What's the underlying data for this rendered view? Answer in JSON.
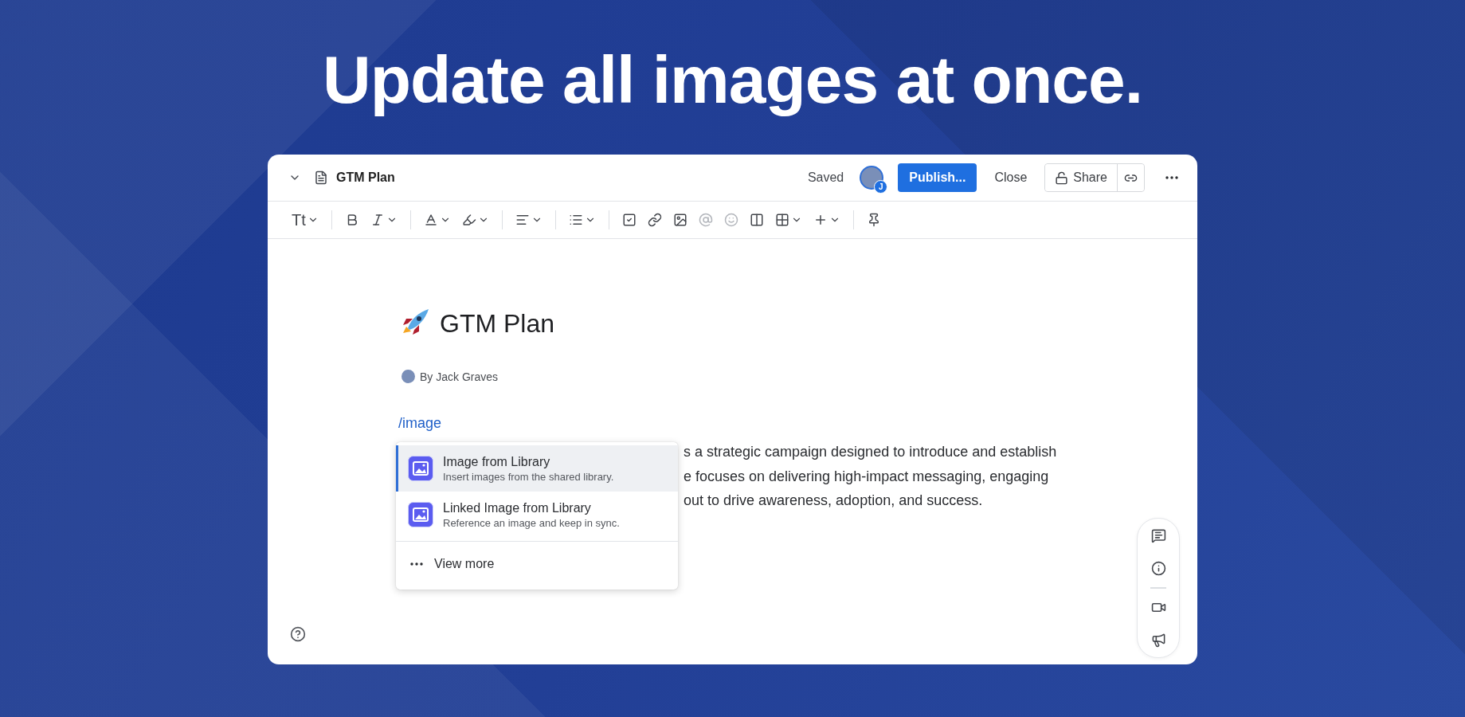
{
  "headline": "Update all images at once.",
  "topbar": {
    "title": "GTM Plan",
    "status": "Saved",
    "avatar_badge": "J",
    "publish": "Publish...",
    "close": "Close",
    "share": "Share"
  },
  "toolbar": {
    "text_style": "Tt",
    "tools": [
      {
        "kind": "text-style",
        "menu": true,
        "disabled": false
      },
      {
        "kind": "separator"
      },
      {
        "kind": "bold",
        "menu": false,
        "disabled": false
      },
      {
        "kind": "italic",
        "menu": true,
        "disabled": false
      },
      {
        "kind": "separator"
      },
      {
        "kind": "text-color",
        "menu": true,
        "disabled": false
      },
      {
        "kind": "highlight",
        "menu": true,
        "disabled": false
      },
      {
        "kind": "separator"
      },
      {
        "kind": "align",
        "menu": true,
        "disabled": false
      },
      {
        "kind": "separator"
      },
      {
        "kind": "list",
        "menu": true,
        "disabled": false
      },
      {
        "kind": "separator"
      },
      {
        "kind": "task",
        "menu": false,
        "disabled": false
      },
      {
        "kind": "link",
        "menu": false,
        "disabled": false
      },
      {
        "kind": "image",
        "menu": false,
        "disabled": false
      },
      {
        "kind": "mention",
        "menu": false,
        "disabled": true
      },
      {
        "kind": "emoji",
        "menu": false,
        "disabled": true
      },
      {
        "kind": "columns",
        "menu": false,
        "disabled": false
      },
      {
        "kind": "table",
        "menu": true,
        "disabled": false
      },
      {
        "kind": "insert",
        "menu": true,
        "disabled": false
      },
      {
        "kind": "separator"
      },
      {
        "kind": "pin",
        "menu": false,
        "disabled": false
      }
    ]
  },
  "document": {
    "title": "GTM Plan",
    "author": "By Jack Graves",
    "command": "/image",
    "paragraph_lines": [
      "s a strategic campaign designed to introduce and establish",
      "e focuses on delivering high-impact messaging, engaging",
      "out to drive awareness, adoption, and success."
    ]
  },
  "menu": {
    "items": [
      {
        "title": "Image from Library",
        "description": "Insert images from the shared library.",
        "selected": true
      },
      {
        "title": "Linked Image from Library",
        "description": "Reference an image and keep in sync.",
        "selected": false
      }
    ],
    "more": "View more"
  },
  "side_panel": {
    "tools": [
      {
        "kind": "comment"
      },
      {
        "kind": "info"
      },
      {
        "kind": "separator"
      },
      {
        "kind": "video"
      },
      {
        "kind": "announce"
      }
    ]
  }
}
